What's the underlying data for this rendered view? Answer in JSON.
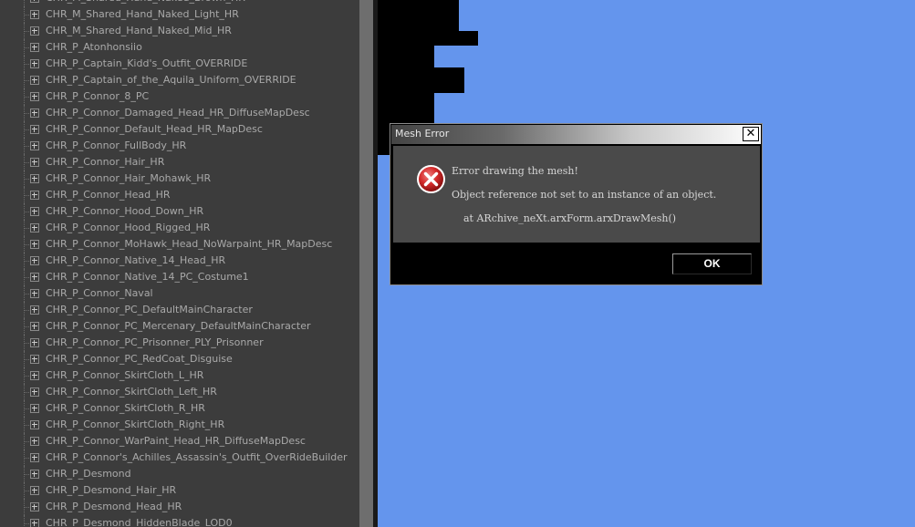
{
  "tree": {
    "items": [
      "CHR_M_Shared_Hand_Naked_Brown_HR",
      "CHR_M_Shared_Hand_Naked_Light_HR",
      "CHR_M_Shared_Hand_Naked_Mid_HR",
      "CHR_P_Atonhonsiio",
      "CHR_P_Captain_Kidd's_Outfit_OVERRIDE",
      "CHR_P_Captain_of_the_Aquila_Uniform_OVERRIDE",
      "CHR_P_Connor_8_PC",
      "CHR_P_Connor_Damaged_Head_HR_DiffuseMapDesc",
      "CHR_P_Connor_Default_Head_HR_MapDesc",
      "CHR_P_Connor_FullBody_HR",
      "CHR_P_Connor_Hair_HR",
      "CHR_P_Connor_Hair_Mohawk_HR",
      "CHR_P_Connor_Head_HR",
      "CHR_P_Connor_Hood_Down_HR",
      "CHR_P_Connor_Hood_Rigged_HR",
      "CHR_P_Connor_MoHawk_Head_NoWarpaint_HR_MapDesc",
      "CHR_P_Connor_Native_14_Head_HR",
      "CHR_P_Connor_Native_14_PC_Costume1",
      "CHR_P_Connor_Naval",
      "CHR_P_Connor_PC_DefaultMainCharacter",
      "CHR_P_Connor_PC_Mercenary_DefaultMainCharacter",
      "CHR_P_Connor_PC_Prisonner_PLY_Prisonner",
      "CHR_P_Connor_PC_RedCoat_Disguise",
      "CHR_P_Connor_SkirtCloth_L_HR",
      "CHR_P_Connor_SkirtCloth_Left_HR",
      "CHR_P_Connor_SkirtCloth_R_HR",
      "CHR_P_Connor_SkirtCloth_Right_HR",
      "CHR_P_Connor_WarPaint_Head_HR_DiffuseMapDesc",
      "CHR_P_Connor's_Achilles_Assassin's_Outfit_OverRideBuilder",
      "CHR_P_Desmond",
      "CHR_P_Desmond_Hair_HR",
      "CHR_P_Desmond_Head_HR",
      "CHR_P_Desmond_HiddenBlade_LOD0"
    ],
    "expander_icon": "plus-box-icon"
  },
  "dialog": {
    "title": "Mesh Error",
    "close_label": "✕",
    "icon": "error-icon",
    "message_title": "Error drawing the mesh!",
    "message_body": "Object reference not set to an instance of an object.",
    "message_trace": "at ARchive_neXt.arxForm.arxDrawMesh()",
    "ok_label": "OK"
  },
  "colors": {
    "viewport_bg": "#6495ed",
    "panel_bg": "#3c3c3c",
    "tree_text": "#a9a9a9",
    "dialog_body_bg": "#4a4a4a",
    "error_red": "#c8202a"
  }
}
